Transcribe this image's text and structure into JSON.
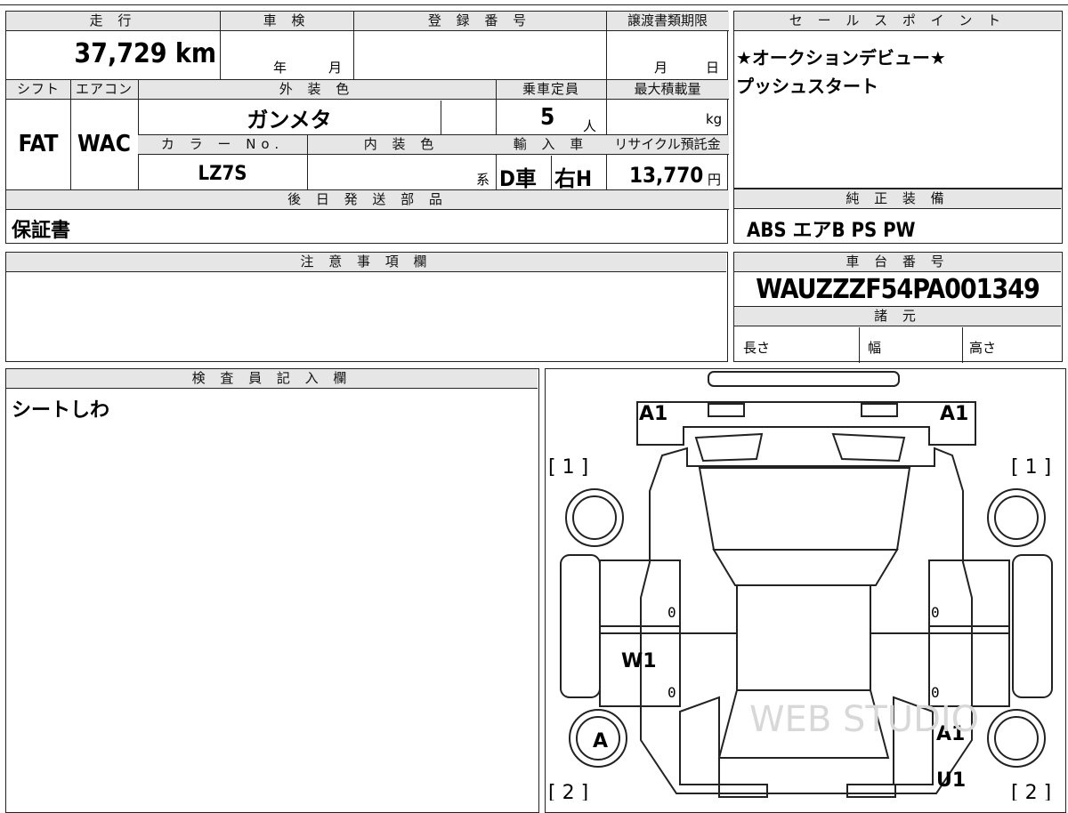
{
  "top_strip": {
    "partial_text": ""
  },
  "mileage": {
    "header": "走 行",
    "value": "37,729 km"
  },
  "shaken": {
    "header": "車 検",
    "year_label": "年",
    "month_label": "月"
  },
  "registration": {
    "header": "登 録 番 号",
    "value": ""
  },
  "transfer_deadline": {
    "header": "譲渡書類期限",
    "month_label": "月",
    "day_label": "日"
  },
  "shift": {
    "header": "シフト",
    "value": "FAT"
  },
  "aircon": {
    "header": "エアコン",
    "value": "WAC"
  },
  "exterior_color": {
    "header": "外 装 色",
    "value": "ガンメタ"
  },
  "capacity": {
    "header": "乗車定員",
    "value": "5",
    "unit": "人"
  },
  "max_load": {
    "header": "最大積載量",
    "unit": "kg"
  },
  "color_no": {
    "header": "カ ラ ー No.",
    "value": "LZ7S"
  },
  "interior_color": {
    "header": "内 装 色",
    "suffix": "系"
  },
  "import": {
    "header": "輸 入 車",
    "type": "D車",
    "handle": "右H"
  },
  "recycle": {
    "header": "リサイクル預託金",
    "value": "13,770",
    "unit": "円"
  },
  "later_parts": {
    "header": "後 日 発 送 部 品",
    "value": "保証書"
  },
  "sales_points": {
    "header": "セ ー ル ス ポ イ ン ト",
    "line1": "★オークションデビュー★",
    "line2": "プッシュスタート"
  },
  "equipment": {
    "header": "純 正 装 備",
    "value": "ABS エアB PS PW"
  },
  "notes": {
    "header": "注 意 事 項 欄",
    "value": ""
  },
  "chassis": {
    "header": "車 台 番 号",
    "value": "WAUZZZF54PA001349"
  },
  "specs": {
    "header": "諸 元",
    "length_label": "長さ",
    "width_label": "幅",
    "height_label": "高さ"
  },
  "inspector": {
    "header": "検 査 員 記 入 欄",
    "value": "シートしわ"
  },
  "diagram": {
    "marks": {
      "front_left": "A1",
      "front_right": "A1",
      "bracket_fl": "[ 1 ]",
      "bracket_fr": "[ 1 ]",
      "bracket_rl": "[ 2 ]",
      "bracket_rr": "[ 2 ]",
      "left_mid": "W1",
      "rear_left": "A",
      "rear_right_a": "A1",
      "rear_right_u": "U1",
      "door_zero_1": "0",
      "door_zero_2": "0",
      "door_zero_3": "0",
      "door_zero_4": "0"
    },
    "watermark": "WEB STUDIO"
  }
}
